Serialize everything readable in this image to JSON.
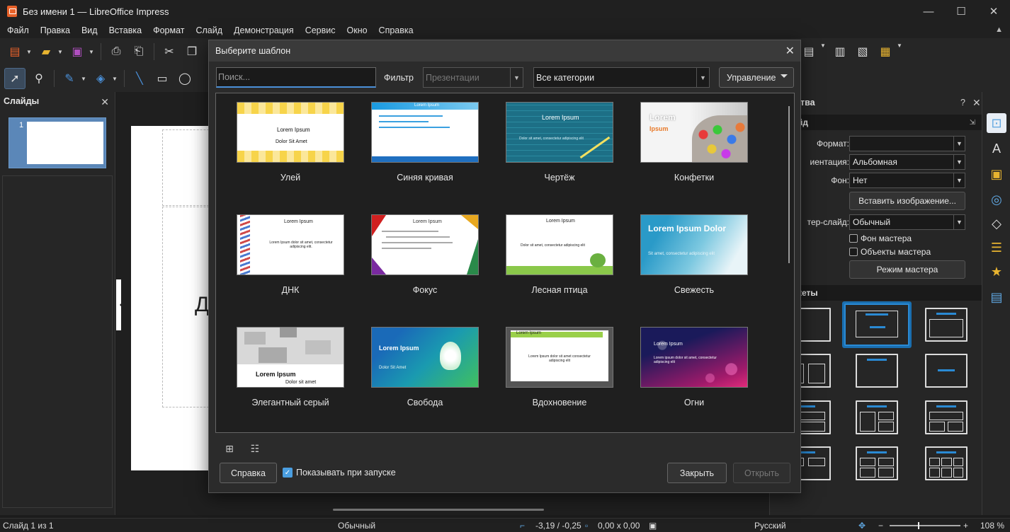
{
  "window": {
    "title": "Без имени 1 — LibreOffice Impress",
    "minimize_icon": "—",
    "maximize_icon": "☐",
    "close_icon": "✕"
  },
  "menu": [
    "Файл",
    "Правка",
    "Вид",
    "Вставка",
    "Формат",
    "Слайд",
    "Демонстрация",
    "Сервис",
    "Окно",
    "Справка"
  ],
  "slides_pane": {
    "title": "Слайды",
    "slide_number": "1"
  },
  "slide_canvas": {
    "partial_text": "Д"
  },
  "sidebar": {
    "title": "ства",
    "help": "?",
    "section_slide": "йд",
    "format_label": "Формат:",
    "format_value": "",
    "orientation_label": "иентация:",
    "orientation_value": "Альбомная",
    "background_label": "Фон:",
    "background_value": "Нет",
    "insert_image_button": "Вставить изображение...",
    "master_slide_label": "тер-слайд:",
    "master_slide_value": "Обычный",
    "master_background_check": "Фон мастера",
    "master_objects_check": "Объекты мастера",
    "master_mode_button": "Режим мастера",
    "section_layouts": "кеты"
  },
  "statusbar": {
    "slide_info": "Слайд 1 из 1",
    "master": "Обычный",
    "position": "-3,19 / -0,25",
    "size": "0,00 x 0,00",
    "language": "Русский",
    "zoom": "108 %",
    "zoom_minus": "−",
    "zoom_plus": "+"
  },
  "dialog": {
    "title": "Выберите шаблон",
    "search_placeholder": "Поиск...",
    "filter_label": "Фильтр",
    "filter_value": "Презентации",
    "category_value": "Все категории",
    "manage_button": "Управление",
    "templates": [
      {
        "name": "Улей",
        "title": "Lorem Ipsum",
        "subtitle": "Dolor Sit Amet"
      },
      {
        "name": "Синяя кривая",
        "title": "Lorem Ipsum",
        "subtitle": ""
      },
      {
        "name": "Чертёж",
        "title": "Lorem Ipsum",
        "subtitle": "Dolor sit amet, consectetur adipiscing elit"
      },
      {
        "name": "Конфетки",
        "title": "Lorem",
        "subtitle": "Ipsum"
      },
      {
        "name": "ДНК",
        "title": "Lorem Ipsum",
        "subtitle": "Lorem Ipsum dolor sit amet, consectetur adipiscing elit."
      },
      {
        "name": "Фокус",
        "title": "Lorem Ipsum",
        "subtitle": ""
      },
      {
        "name": "Лесная птица",
        "title": "Lorem Ipsum",
        "subtitle": "Dolor sit amet, consectetur adipiscing elit"
      },
      {
        "name": "Свежесть",
        "title": "Lorem Ipsum Dolor",
        "subtitle": "Sit amet, consectetur adipiscing elit"
      },
      {
        "name": "Элегантный серый",
        "title": "Lorem Ipsum",
        "subtitle": "Dolor sit amet"
      },
      {
        "name": "Свобода",
        "title": "Lorem Ipsum",
        "subtitle": "Dolor Sit Amet"
      },
      {
        "name": "Вдохновение",
        "title": "Lorem Ipsum",
        "subtitle": "Lorem Ipsum dolor sit amet consectetur adipiscing elit"
      },
      {
        "name": "Огни",
        "title": "Lorem Ipsum",
        "subtitle": "Lorem ipsum dolor sit amet, consectetur adipiscing elit"
      }
    ],
    "help_button": "Справка",
    "show_on_startup": "Показывать при запуске",
    "close_button": "Закрыть",
    "open_button": "Открыть"
  }
}
